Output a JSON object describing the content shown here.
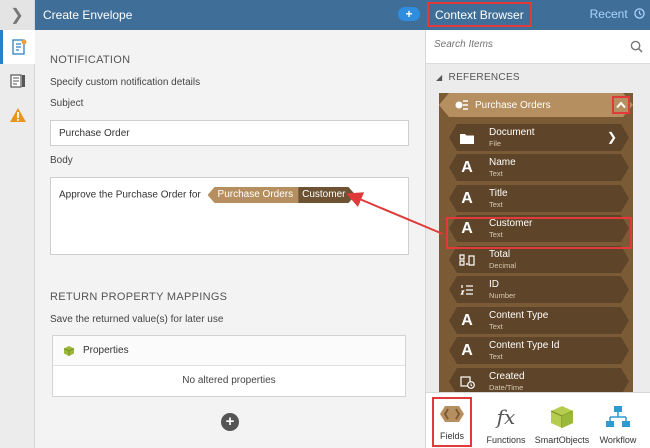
{
  "header": {
    "title": "Create Envelope",
    "add_label": "+",
    "context_browser": "Context Browser",
    "recent": "Recent"
  },
  "notification": {
    "section_title": "NOTIFICATION",
    "description": "Specify custom notification details",
    "subject_label": "Subject",
    "subject_value": "Purchase Order",
    "body_label": "Body",
    "body_text": "Approve the Purchase Order for",
    "chip_parent": "Purchase Orders",
    "chip_child": "Customer"
  },
  "return_mappings": {
    "section_title": "RETURN PROPERTY MAPPINGS",
    "description": "Save the returned value(s) for later use",
    "properties_label": "Properties",
    "empty_text": "No altered properties"
  },
  "context_browser": {
    "search_placeholder": "Search Items",
    "references_label": "REFERENCES",
    "root": "Purchase Orders",
    "items": [
      {
        "name": "Document",
        "type": "File",
        "icon": "folder-icon"
      },
      {
        "name": "Name",
        "type": "Text",
        "icon": "text-icon"
      },
      {
        "name": "Title",
        "type": "Text",
        "icon": "text-icon"
      },
      {
        "name": "Customer",
        "type": "Text",
        "icon": "text-icon"
      },
      {
        "name": "Total",
        "type": "Decimal",
        "icon": "decimal-icon"
      },
      {
        "name": "ID",
        "type": "Number",
        "icon": "number-icon"
      },
      {
        "name": "Content Type",
        "type": "Text",
        "icon": "text-icon"
      },
      {
        "name": "Content Type Id",
        "type": "Text",
        "icon": "text-icon"
      },
      {
        "name": "Created",
        "type": "Date/Time",
        "icon": "datetime-icon"
      }
    ]
  },
  "tabs": [
    {
      "label": "Fields"
    },
    {
      "label": "Functions"
    },
    {
      "label": "SmartObjects"
    },
    {
      "label": "Workflow"
    }
  ],
  "colors": {
    "header": "#3f6f98",
    "chip_light": "#b58f5f",
    "chip_dark": "#6d5233",
    "highlight": "#e03a3a"
  }
}
